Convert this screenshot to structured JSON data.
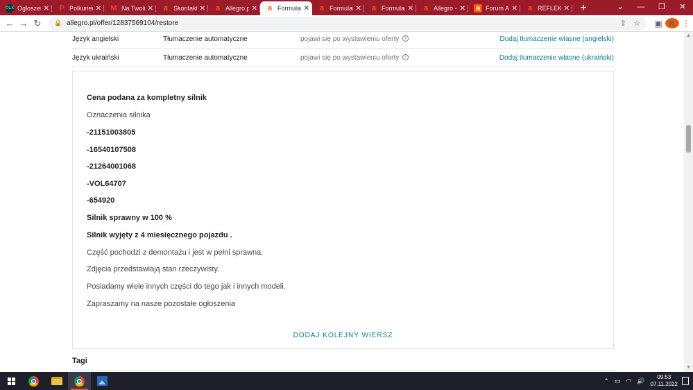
{
  "tabs": [
    {
      "title": "Ogłoszeni",
      "favicon": "olx-icon",
      "favtext": "OLX",
      "favcolor": "#23e5db"
    },
    {
      "title": "Polkurier",
      "favicon": "polkurier-icon",
      "favtext": "P",
      "favcolor": "#e53935"
    },
    {
      "title": "Na Twoim",
      "favicon": "gmail-icon",
      "favtext": "M",
      "favcolor": "#ea4335"
    },
    {
      "title": "Skontakt",
      "favicon": "allegro-icon",
      "favtext": "a",
      "favcolor": "#ff5a00"
    },
    {
      "title": "Allegro.pl",
      "favicon": "allegro-icon",
      "favtext": "a",
      "favcolor": "#ff5a00"
    },
    {
      "title": "Formular",
      "favicon": "allegro-icon",
      "favtext": "a",
      "favcolor": "#ff5a00",
      "active": true
    },
    {
      "title": "Formular",
      "favicon": "allegro-icon",
      "favtext": "a",
      "favcolor": "#ff5a00"
    },
    {
      "title": "Formular",
      "favicon": "allegro-icon",
      "favtext": "a",
      "favcolor": "#ff5a00"
    },
    {
      "title": "Allegro -",
      "favicon": "allegro-icon",
      "favtext": "a",
      "favcolor": "#ff5a00"
    },
    {
      "title": "Forum Al",
      "favicon": "allegro-forum-icon",
      "favtext": "a",
      "favcolor": "#ff5a00"
    },
    {
      "title": "REFLEKTO",
      "favicon": "allegro-icon",
      "favtext": "a",
      "favcolor": "#ff5a00"
    }
  ],
  "address": {
    "url": "allegro.pl/offer/12837569104/restore",
    "avatar_letter": "K"
  },
  "translations": [
    {
      "lang": "Język angielski",
      "type": "Tłumaczenie automatyczne",
      "info": "pojawi się po wystawieniu oferty",
      "add": "Dodaj tłumaczenie własne (angielski)"
    },
    {
      "lang": "Język ukraiński",
      "type": "Tłumaczenie automatyczne",
      "info": "pojawi się po wystawieniu oferty",
      "add": "Dodaj tłumaczenie własne (ukraiński)"
    }
  ],
  "description": {
    "lines": [
      {
        "text": "Cena podana za kompletny silnik",
        "bold": true
      },
      {
        "text": "Oznaczenia silnika",
        "bold": false
      },
      {
        "text": "-21151003805",
        "bold": true
      },
      {
        "text": "-16540107508",
        "bold": true
      },
      {
        "text": "-21264001068",
        "bold": true
      },
      {
        "text": "-VOL64707",
        "bold": true
      },
      {
        "text": "-654920",
        "bold": true
      },
      {
        "text": "Silnik sprawny w 100 %",
        "bold": true
      },
      {
        "text": "Silnik wyjęty z 4 miesięcznego pojazdu .",
        "bold": true
      },
      {
        "text": "Część pochodzi z demontażu i jest w pełni sprawna.",
        "bold": false
      },
      {
        "text": "Zdjęcia przedstawiają stan rzeczywisty.",
        "bold": false
      },
      {
        "text": "Posiadamy wiele innych części do tego jak i innych modeli.",
        "bold": false
      },
      {
        "text": "Zapraszamy na nasze pozostałe ogłoszenia",
        "bold": false
      }
    ],
    "add_row": "DODAJ KOLEJNY WIERSZ"
  },
  "tags_heading": "Tagi",
  "taskbar": {
    "time": "09:53",
    "date": "07.11.2022"
  },
  "colors": {
    "accent": "#0a7e8c",
    "tabstrip": "#9b1b2a",
    "taskbar": "#1f1f2b"
  }
}
